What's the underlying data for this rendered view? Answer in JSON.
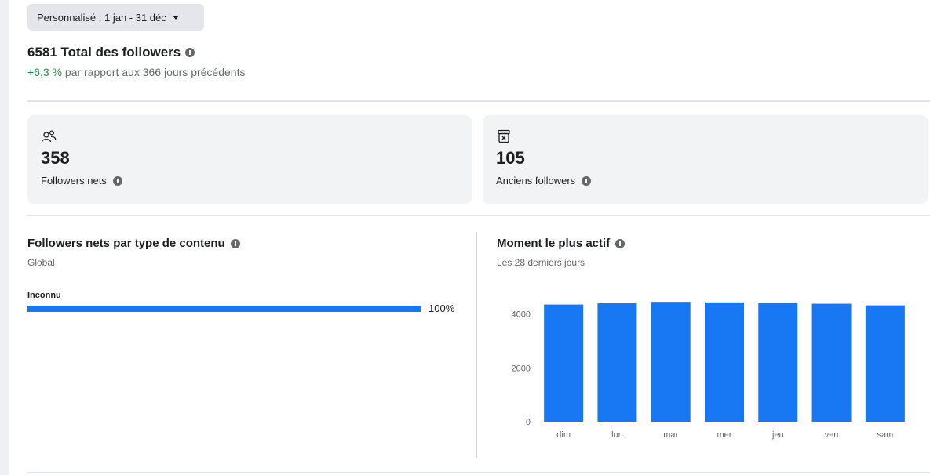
{
  "date_filter": {
    "label": "Personnalisé : 1 jan - 31 déc"
  },
  "summary": {
    "total_title": "6581 Total des followers",
    "delta": "+6,3 %",
    "delta_context": " par rapport aux 366 jours précédents"
  },
  "cards": [
    {
      "icon": "people-icon",
      "value": "358",
      "label": "Followers nets"
    },
    {
      "icon": "archive-x-icon",
      "value": "105",
      "label": "Anciens followers"
    }
  ],
  "content_type": {
    "title": "Followers nets par type de contenu",
    "subtitle": "Global",
    "bar": {
      "label": "Inconnu",
      "value_text": "100%",
      "fraction": 1.0
    }
  },
  "active_time": {
    "title": "Moment le plus actif",
    "subtitle": "Les 28 derniers jours"
  },
  "colors": {
    "accent": "#1877f2",
    "positive": "#1e8e3e"
  },
  "chart_data": {
    "type": "bar",
    "categories": [
      "dim",
      "lun",
      "mar",
      "mer",
      "jeu",
      "ven",
      "sam"
    ],
    "values": [
      4350,
      4400,
      4450,
      4430,
      4410,
      4380,
      4320
    ],
    "yticks": [
      0,
      2000,
      4000
    ],
    "ylim": [
      0,
      4600
    ],
    "grid": false,
    "legend": "none"
  }
}
